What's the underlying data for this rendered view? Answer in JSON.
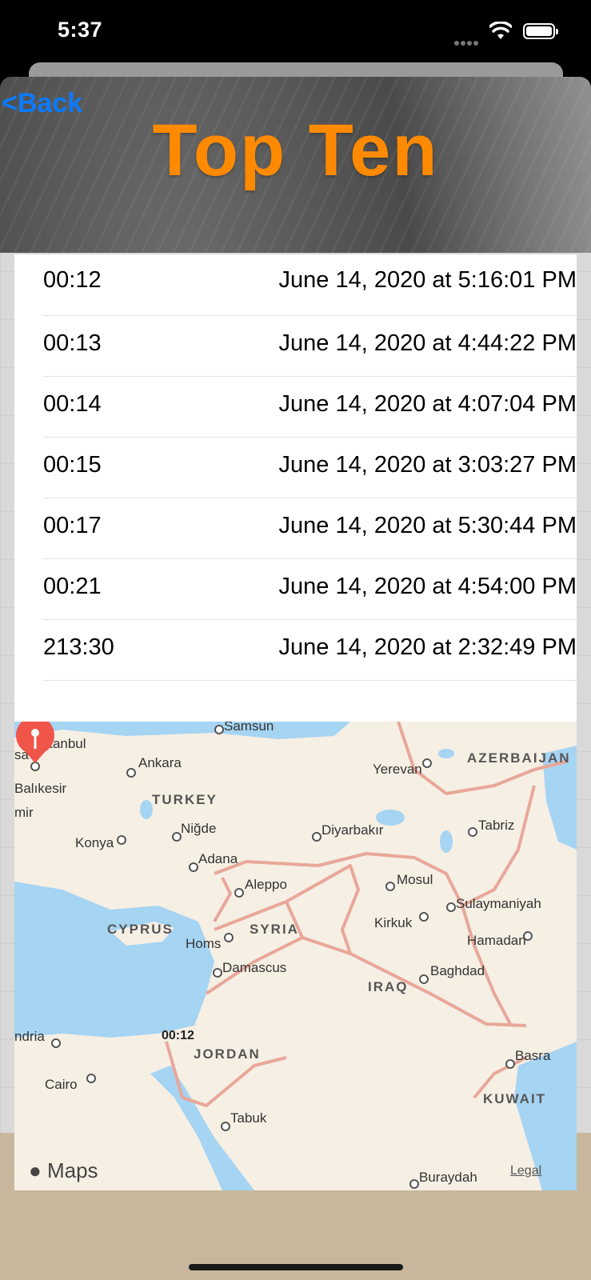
{
  "status_bar": {
    "time": "5:37"
  },
  "nav": {
    "back_label": "<Back",
    "title": "Top Ten"
  },
  "scores": [
    {
      "time": "00:12",
      "date": "June 14, 2020 at 5:16:01 PM"
    },
    {
      "time": "00:13",
      "date": "June 14, 2020 at 4:44:22 PM"
    },
    {
      "time": "00:14",
      "date": "June 14, 2020 at 4:07:04 PM"
    },
    {
      "time": "00:15",
      "date": "June 14, 2020 at 3:03:27 PM"
    },
    {
      "time": "00:17",
      "date": "June 14, 2020 at 5:30:44 PM"
    },
    {
      "time": "00:21",
      "date": "June 14, 2020 at 4:54:00 PM"
    },
    {
      "time": "213:30",
      "date": "June 14, 2020 at 2:32:49 PM"
    }
  ],
  "map": {
    "pin_label": "00:12",
    "brand": "Maps",
    "legal": "Legal",
    "countries": {
      "turkey": "TURKEY",
      "cyprus": "CYPRUS",
      "syria": "SYRIA",
      "iraq": "IRAQ",
      "jordan": "JORDAN",
      "kuwait": "KUWAIT",
      "azerbaijan": "AZERBAIJAN"
    },
    "cities": {
      "samsun": "Samsun",
      "istanbul": "Istanbul",
      "ankara": "Ankara",
      "balikesir": "Balıkesir",
      "konya": "Konya",
      "nigde": "Niğde",
      "adana": "Adana",
      "aleppo": "Aleppo",
      "homs": "Homs",
      "damascus": "Damascus",
      "diyarbakir": "Diyarbakır",
      "mosul": "Mosul",
      "kirkuk": "Kirkuk",
      "sulaymaniyah": "Sulaymaniyah",
      "hamadan": "Hamadan",
      "baghdad": "Baghdad",
      "basra": "Basra",
      "tabuk": "Tabuk",
      "cairo": "Cairo",
      "alexandria": "ndria",
      "buraydah": "Buraydah",
      "yerevan": "Yerevan",
      "tabriz": "Tabriz",
      "sa": "sa",
      "mir": "mir"
    }
  },
  "colors": {
    "accent": "#0a7aff",
    "title": "#ff8a00",
    "pin": "#f0554a",
    "water": "#a6d4f3",
    "land": "#f6efe4",
    "border": "#e8a79a"
  }
}
